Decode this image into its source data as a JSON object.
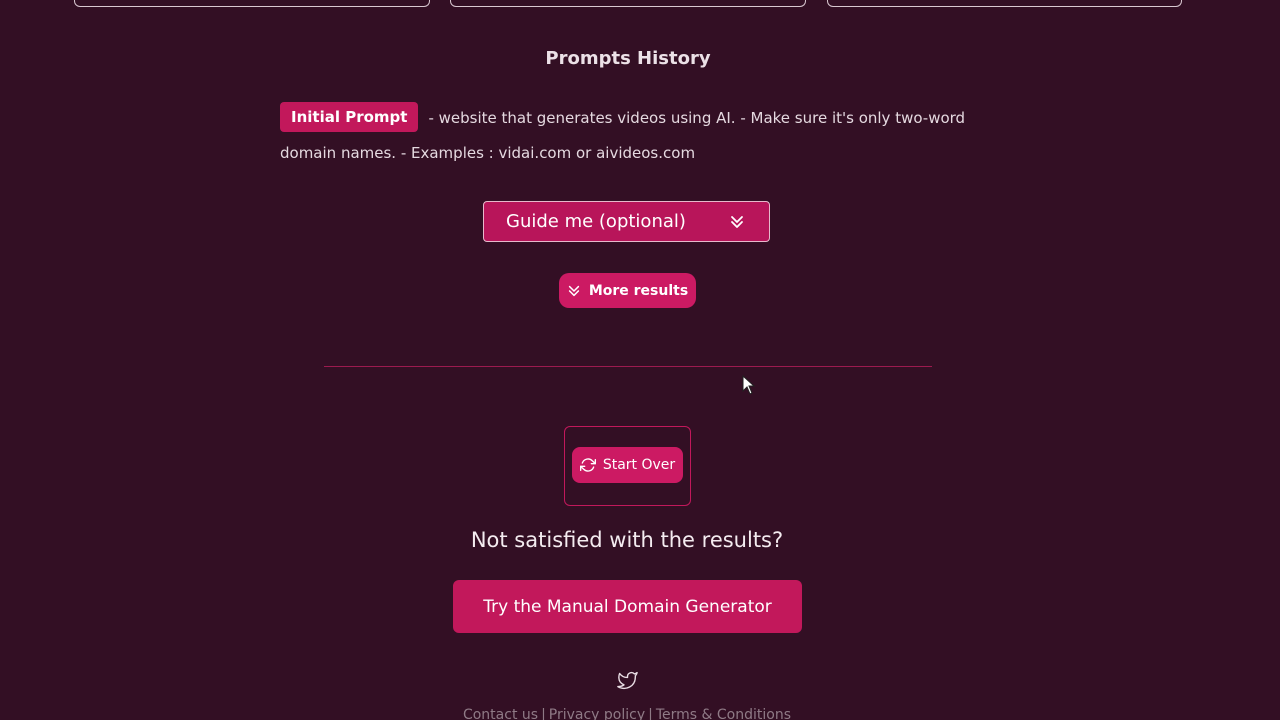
{
  "history": {
    "title": "Prompts History",
    "badge": "Initial Prompt",
    "prompt_text": "- website that generates videos using AI. - Make sure it's only two-word domain names. - Examples : vidai.com or aivideos.com"
  },
  "guide": {
    "label": "Guide me (optional)",
    "icon": "chevron-double-down-icon"
  },
  "more_results": {
    "label": "More results",
    "icon": "chevron-double-down-icon"
  },
  "start_over": {
    "label": "Start Over",
    "icon": "refresh-icon"
  },
  "satisfaction": {
    "question": "Not satisfied with the results?",
    "manual_button": "Try the Manual Domain Generator"
  },
  "social": {
    "icon": "twitter-icon"
  },
  "footer": {
    "contact": "Contact us",
    "privacy": "Privacy policy",
    "terms": "Terms & Conditions",
    "separator": "|"
  },
  "colors": {
    "background": "#330f24",
    "accent": "#c2185b",
    "accent_light": "#cc1a63"
  }
}
